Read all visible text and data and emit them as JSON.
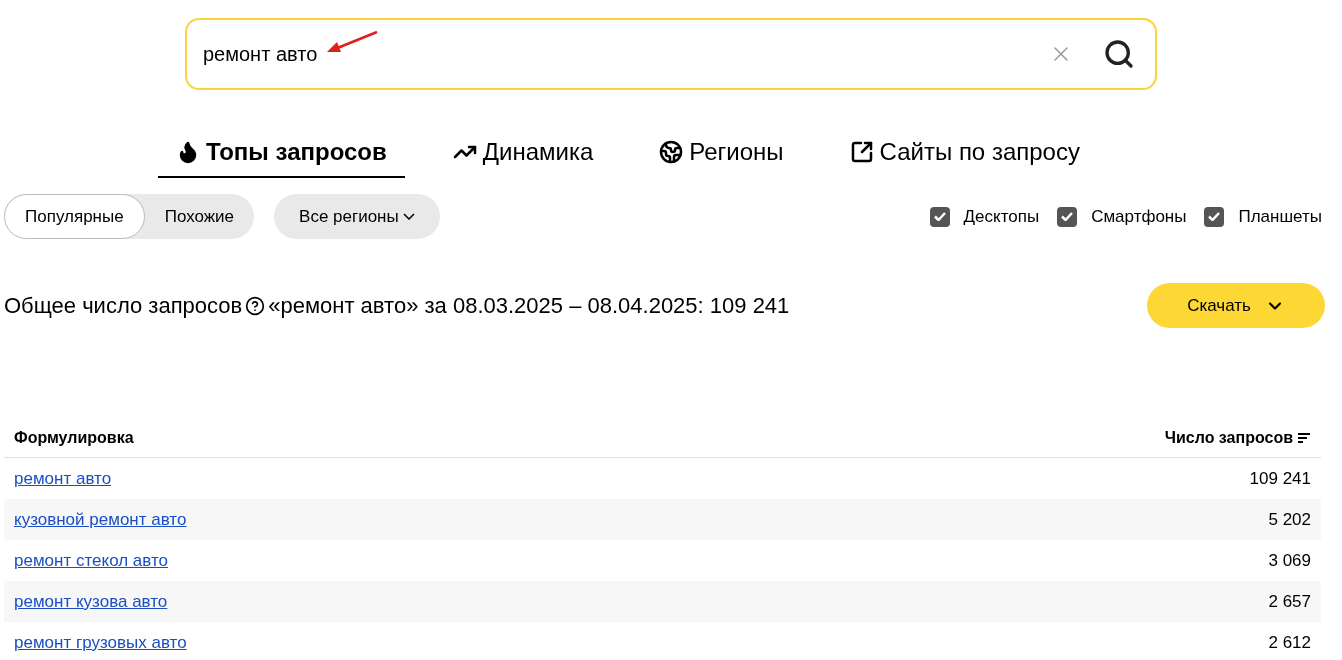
{
  "search": {
    "value": "ремонт авто"
  },
  "tabs": [
    {
      "label": "Топы запросов",
      "selected": true,
      "kind": "flame"
    },
    {
      "label": "Динамика",
      "selected": false,
      "kind": "trend"
    },
    {
      "label": "Регионы",
      "selected": false,
      "kind": "globe"
    },
    {
      "label": "Сайты по запросу",
      "selected": false,
      "kind": "external"
    }
  ],
  "mode_toggle": [
    {
      "label": "Популярные",
      "selected": true
    },
    {
      "label": "Похожие",
      "selected": false
    }
  ],
  "region_select": {
    "label": "Все регионы"
  },
  "devices": [
    {
      "label": "Десктопы",
      "checked": true
    },
    {
      "label": "Смартфоны",
      "checked": true
    },
    {
      "label": "Планшеты",
      "checked": true
    }
  ],
  "summary": {
    "label": "Общее число запросов",
    "text": "«ремонт авто» за 08.03.2025 – 08.04.2025: 109 241"
  },
  "download_button": {
    "label": "Скачать"
  },
  "table": {
    "columns": [
      "Формулировка",
      "Число запросов"
    ],
    "rows": [
      {
        "query": "ремонт авто",
        "count": "109 241"
      },
      {
        "query": "кузовной ремонт авто",
        "count": "5 202"
      },
      {
        "query": "ремонт стекол авто",
        "count": "3 069"
      },
      {
        "query": "ремонт кузова авто",
        "count": "2 657"
      },
      {
        "query": "ремонт грузовых авто",
        "count": "2 612"
      }
    ]
  }
}
